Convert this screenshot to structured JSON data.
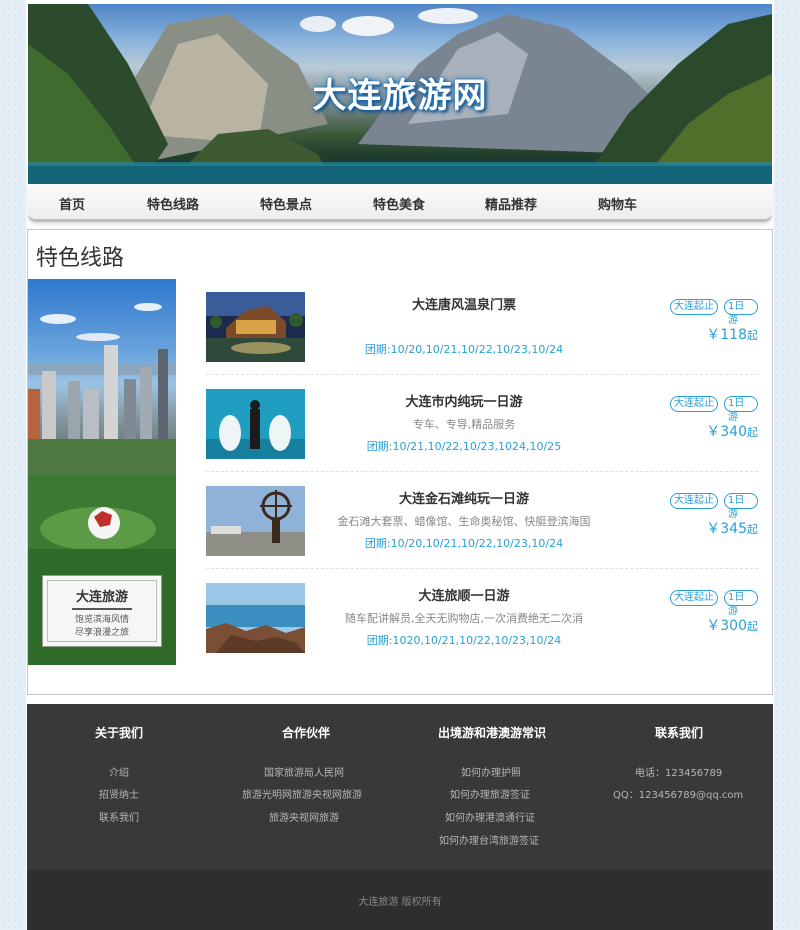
{
  "banner": {
    "title": "大连旅游网"
  },
  "nav": {
    "items": [
      "首页",
      "特色线路",
      "特色景点",
      "特色美食",
      "精品推荐",
      "购物车"
    ]
  },
  "section": {
    "title": "特色线路"
  },
  "promo": {
    "title": "大连旅游",
    "lines": [
      "饱览滨海风情",
      "尽享浪漫之旅"
    ]
  },
  "routes": [
    {
      "name": "大连唐风温泉门票",
      "desc": "",
      "dates": "团期:10/20,10/21,10/22,10/23,10/24",
      "tags": [
        "大连起止",
        "1日游"
      ],
      "price": "￥118",
      "price_unit": "起"
    },
    {
      "name": "大连市内纯玩一日游",
      "desc": "专车、专导,精品服务",
      "dates": "团期:10/21,10/22,10/23,1024,10/25",
      "tags": [
        "大连起止",
        "1日游"
      ],
      "price": "￥340",
      "price_unit": "起"
    },
    {
      "name": "大连金石滩纯玩一日游",
      "desc": "金石滩大套票、蜡像馆、生命奥秘馆、快艇登滨海国",
      "dates": "团期:10/20,10/21,10/22,10/23,10/24",
      "tags": [
        "大连起止",
        "1日游"
      ],
      "price": "￥345",
      "price_unit": "起"
    },
    {
      "name": "大连旅顺一日游",
      "desc": "随车配讲解员,全天无购物店,一次消费绝无二次消",
      "dates": "团期:1020,10/21,10/22,10/23,10/24",
      "tags": [
        "大连起止",
        "1日游"
      ],
      "price": "￥300",
      "price_unit": "起"
    }
  ],
  "footer": {
    "columns": [
      {
        "title": "关于我们",
        "links": [
          "介绍",
          "招贤纳士",
          "联系我们"
        ]
      },
      {
        "title": "合作伙伴",
        "links": [
          "国家旅游局人民网",
          "旅游光明网旅游央视网旅游",
          "旅游央视网旅游"
        ]
      },
      {
        "title": "出境游和港澳游常识",
        "links": [
          "如何办理护照",
          "如何办理旅游签证",
          "如何办理港澳通行证",
          "如何办理台湾旅游签证"
        ]
      },
      {
        "title": "联系我们",
        "links": [
          "电话：123456789",
          "QQ：123456789@qq.com"
        ]
      }
    ],
    "copyright": "大连旅游 版权所有"
  }
}
